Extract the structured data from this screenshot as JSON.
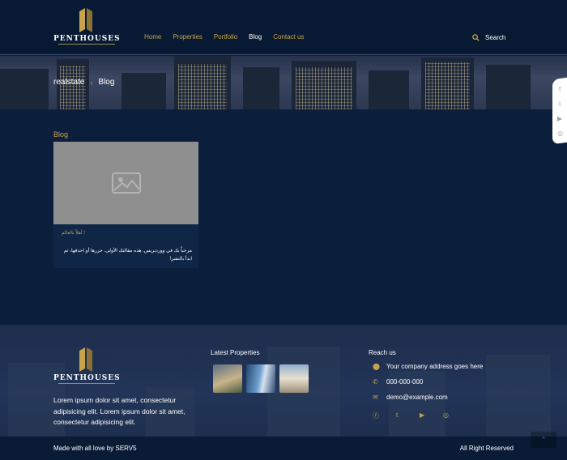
{
  "header": {
    "logo_text": "PENTHOUSES",
    "nav": [
      {
        "label": "Home",
        "active": false
      },
      {
        "label": "Properties",
        "active": false
      },
      {
        "label": "Portfolio",
        "active": false
      },
      {
        "label": "Blog",
        "active": true
      },
      {
        "label": "Contact us",
        "active": false
      }
    ],
    "search_label": "Search"
  },
  "breadcrumb": {
    "root": "realstate",
    "current": "Blog"
  },
  "side_social": [
    "facebook-icon",
    "twitter-icon",
    "youtube-icon",
    "whatsapp-icon"
  ],
  "main": {
    "section_title": "Blog",
    "post": {
      "title": "أهلاً بالعالم !",
      "excerpt": "مرحباً بك في ووردبريس. هذه مقالتك الأولى. حررها أو احذفها، ثم ابدأ بالنشر!"
    }
  },
  "footer": {
    "logo_text": "PENTHOUSES",
    "about": "Lorem ipsum dolor sit amet, consectetur adipisicing elit. Lorem ipsum dolor sit amet, consectetur adipisicing elit.",
    "latest_title": "Latest Properties",
    "reach_title": "Reach us",
    "address": "Your company address goes here",
    "phone": "000-000-000",
    "email": "demo@example.com",
    "social": [
      "facebook-icon",
      "twitter-icon",
      "youtube-icon",
      "whatsapp-icon"
    ],
    "credit": "Made with all love by SERV5",
    "rights": "All Right Reserved"
  },
  "colors": {
    "accent": "#c9a34a",
    "background": "#0b1f3c"
  }
}
